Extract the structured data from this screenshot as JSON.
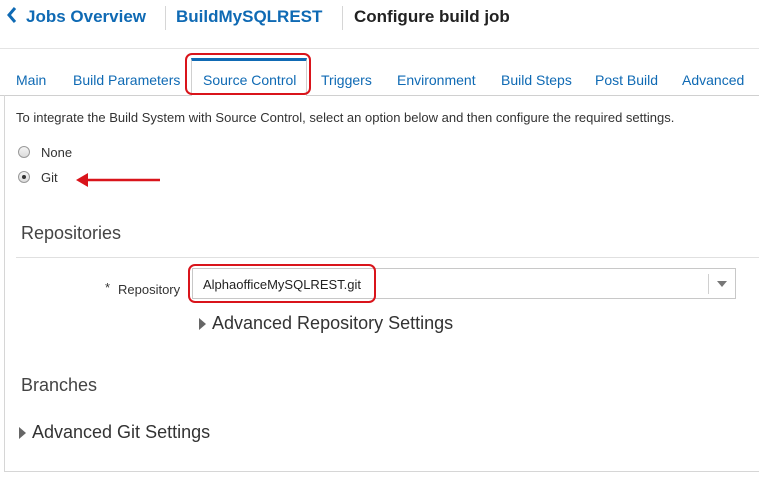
{
  "header": {
    "back_icon": "chevron-left-icon",
    "breadcrumb": [
      "Jobs Overview",
      "BuildMySQLREST"
    ],
    "title": "Configure build job"
  },
  "tabs": [
    {
      "label": "Main"
    },
    {
      "label": "Build Parameters"
    },
    {
      "label": "Source Control",
      "active": true
    },
    {
      "label": "Triggers"
    },
    {
      "label": "Environment"
    },
    {
      "label": "Build Steps"
    },
    {
      "label": "Post Build"
    },
    {
      "label": "Advanced"
    }
  ],
  "source_control": {
    "intro": "To integrate the Build System with Source Control, select an option below and then configure the required settings.",
    "options": [
      {
        "label": "None",
        "selected": false
      },
      {
        "label": "Git",
        "selected": true
      }
    ]
  },
  "repositories": {
    "title": "Repositories",
    "required_marker": "*",
    "repository_label": "Repository",
    "repository_value": "AlphaofficeMySQLREST.git",
    "advanced_label": "Advanced Repository Settings"
  },
  "branches": {
    "title": "Branches",
    "advanced_git_label": "Advanced Git Settings"
  },
  "colors": {
    "link": "#0f6ab4",
    "annotation": "#d9141b",
    "text": "#333333"
  }
}
